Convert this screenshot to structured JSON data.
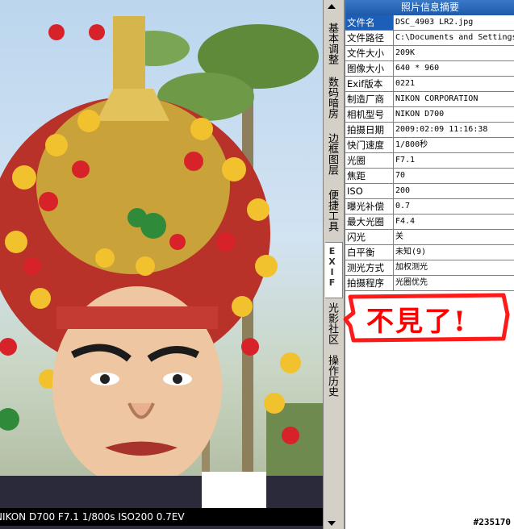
{
  "photo": {
    "caption": "NIKON D700 F7.1 1/800s ISO200 0.7EV",
    "subject": "temple festival statue with ornate pom-pom headdress"
  },
  "tabs": [
    {
      "label": "基本调整"
    },
    {
      "label": "数码暗房"
    },
    {
      "label": "边框图层"
    },
    {
      "label": "便捷工具"
    },
    {
      "label": "EXIF"
    },
    {
      "label": "光影社区"
    },
    {
      "label": "操作历史"
    }
  ],
  "panel": {
    "title": "照片信息摘要",
    "rows": [
      {
        "key": "文件名",
        "value": "DSC_4903 LR2.jpg"
      },
      {
        "key": "文件路径",
        "value": "C:\\Documents and Settings"
      },
      {
        "key": "文件大小",
        "value": "209K"
      },
      {
        "key": "图像大小",
        "value": "640 * 960"
      },
      {
        "key": "Exif版本",
        "value": "0221"
      },
      {
        "key": "制造厂商",
        "value": "NIKON CORPORATION"
      },
      {
        "key": "相机型号",
        "value": "NIKON D700"
      },
      {
        "key": "拍摄日期",
        "value": "2009:02:09 11:16:38"
      },
      {
        "key": "快门速度",
        "value": "1/800秒"
      },
      {
        "key": "光圈",
        "value": "F7.1"
      },
      {
        "key": "焦距",
        "value": "70"
      },
      {
        "key": "ISO",
        "value": "200"
      },
      {
        "key": "曝光补偿",
        "value": "0.7"
      },
      {
        "key": "最大光圈",
        "value": "F4.4"
      },
      {
        "key": "闪光",
        "value": "关"
      },
      {
        "key": "白平衡",
        "value": "未知(9)"
      },
      {
        "key": "测光方式",
        "value": "加权测光"
      },
      {
        "key": "拍摄程序",
        "value": "光圈优先"
      }
    ]
  },
  "annotation": {
    "text": "不見了!",
    "color": "#ff0000"
  },
  "watermark": "#235170",
  "colors": {
    "panel_title_bg": "#1e5aa8",
    "selected_key_bg": "#1c5fb8",
    "tabstrip_bg": "#d4d0c8"
  }
}
